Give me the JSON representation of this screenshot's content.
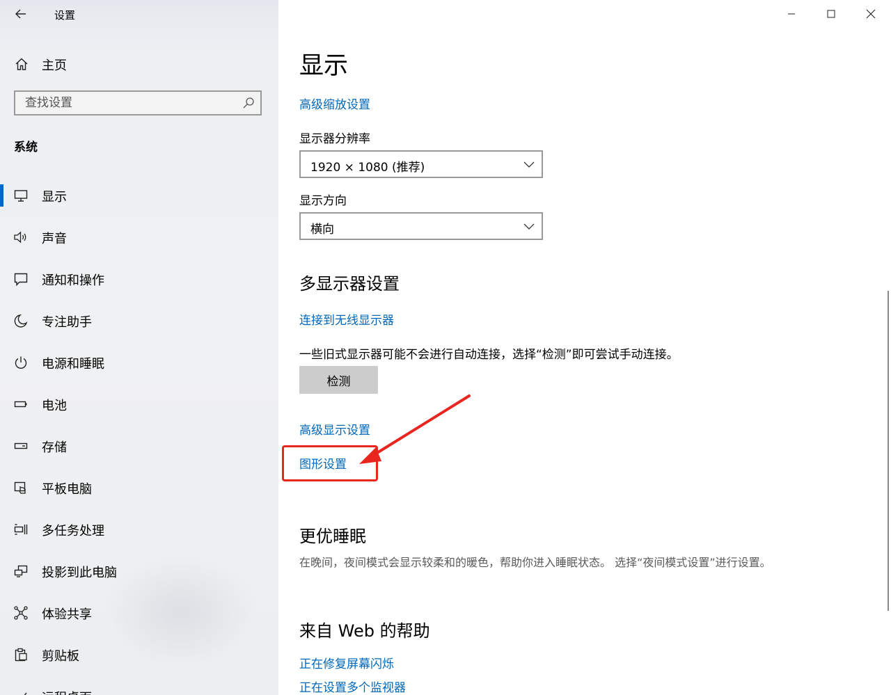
{
  "window": {
    "app_title": "设置",
    "colors": {
      "accent": "#0067c0",
      "link": "#0067b8",
      "annotation": "#e8251f"
    }
  },
  "sidebar": {
    "home_label": "主页",
    "search_placeholder": "查找设置",
    "section_title": "系统",
    "items": [
      {
        "label": "显示",
        "icon": "monitor-icon",
        "active": true
      },
      {
        "label": "声音",
        "icon": "speaker-icon"
      },
      {
        "label": "通知和操作",
        "icon": "notification-icon"
      },
      {
        "label": "专注助手",
        "icon": "moon-icon"
      },
      {
        "label": "电源和睡眠",
        "icon": "power-icon"
      },
      {
        "label": "电池",
        "icon": "battery-icon"
      },
      {
        "label": "存储",
        "icon": "storage-icon"
      },
      {
        "label": "平板电脑",
        "icon": "tablet-icon"
      },
      {
        "label": "多任务处理",
        "icon": "multitask-icon"
      },
      {
        "label": "投影到此电脑",
        "icon": "project-icon"
      },
      {
        "label": "体验共享",
        "icon": "share-icon"
      },
      {
        "label": "剪贴板",
        "icon": "clipboard-icon"
      },
      {
        "label": "远程桌面",
        "icon": "remote-desktop-icon"
      }
    ]
  },
  "main": {
    "title": "显示",
    "advanced_scaling_link": "高级缩放设置",
    "resolution_label": "显示器分辨率",
    "resolution_value": "1920 × 1080 (推荐)",
    "orientation_label": "显示方向",
    "orientation_value": "横向",
    "multi_display_heading": "多显示器设置",
    "wireless_link": "连接到无线显示器",
    "detect_description": "一些旧式显示器可能不会进行自动连接，选择“检测”即可尝试手动连接。",
    "detect_button": "检测",
    "advanced_display_link": "高级显示设置",
    "graphics_settings_link": "图形设置",
    "better_sleep_heading": "更优睡眠",
    "better_sleep_description": "在晚间，夜间模式会显示较柔和的暖色，帮助你进入睡眠状态。 选择“夜间模式设置”进行设置。",
    "web_help_heading": "来自 Web 的帮助",
    "help_links": [
      "正在修复屏幕闪烁",
      "正在设置多个监视器"
    ]
  }
}
